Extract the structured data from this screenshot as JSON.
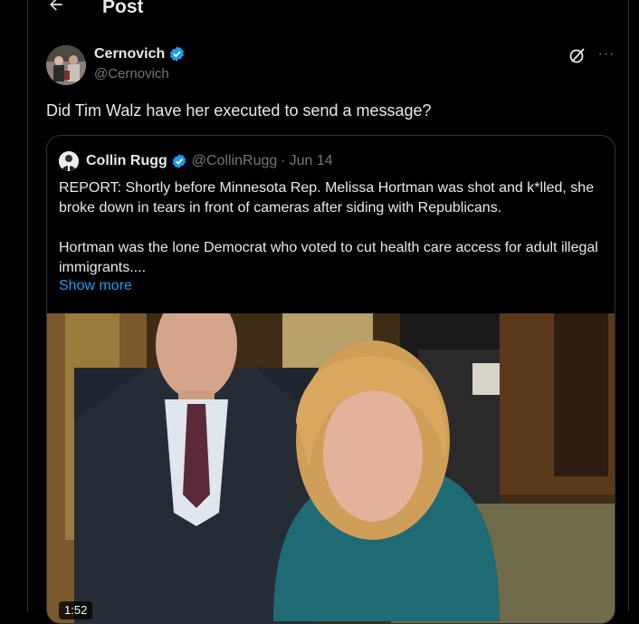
{
  "header": {
    "title": "Post",
    "back_icon": "arrow-left-icon"
  },
  "post": {
    "author": {
      "display_name": "Cernovich",
      "handle": "@Cernovich",
      "verified": true
    },
    "text": "Did Tim Walz have her executed to send a message?",
    "actions": {
      "grok_icon": "grok-icon",
      "more_icon": "more-icon",
      "more_glyph": "···"
    },
    "quote": {
      "author": {
        "display_name": "Collin Rugg",
        "handle": "@CollinRugg",
        "verified": true
      },
      "separator": "·",
      "date": "Jun 14",
      "paragraphs": [
        "REPORT: Shortly before Minnesota Rep. Melissa Hortman was shot and k*lled, she broke down in tears in front of cameras after siding with Republicans.",
        "Hortman was the lone Democrat who voted to cut health care access for adult illegal immigrants...."
      ],
      "show_more_label": "Show more",
      "media": {
        "type": "video",
        "duration": "1:52"
      }
    }
  },
  "colors": {
    "background": "#000000",
    "text": "#e7e9ea",
    "secondary_text": "#71767b",
    "accent": "#1d9bf0",
    "border": "#2f3336"
  }
}
